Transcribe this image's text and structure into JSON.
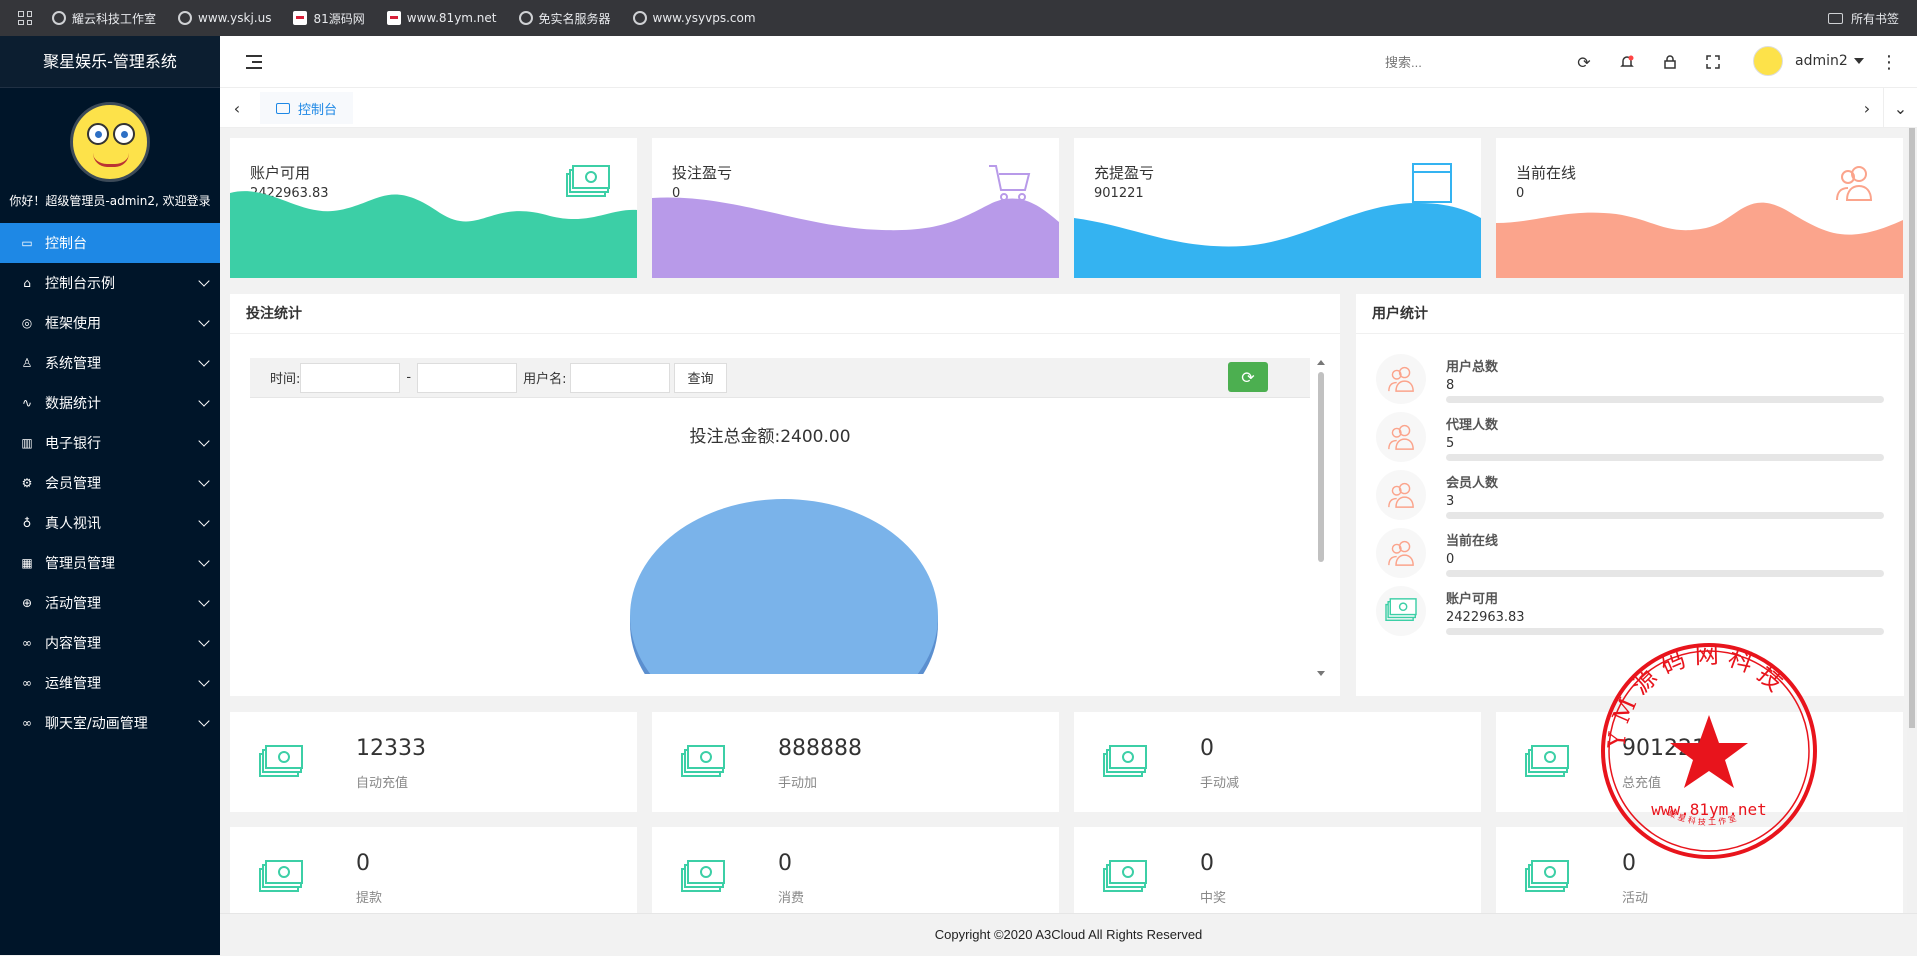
{
  "browser": {
    "bookmarks": [
      {
        "label": "耀云科技工作室",
        "icon": "globe-icon"
      },
      {
        "label": "www.yskj.us",
        "icon": "globe-icon"
      },
      {
        "label": "81源码网",
        "icon": "site-icon"
      },
      {
        "label": "www.81ym.net",
        "icon": "site-icon"
      },
      {
        "label": "免实名服务器",
        "icon": "globe-icon"
      },
      {
        "label": "www.ysyvps.com",
        "icon": "globe-icon"
      }
    ],
    "all_bookmarks": "所有书签"
  },
  "sidebar": {
    "title": "聚星娱乐-管理系统",
    "welcome": "你好！超级管理员-admin2, 欢迎登录",
    "items": [
      {
        "label": "控制台",
        "icon": "monitor-icon",
        "active": true,
        "chevron": false
      },
      {
        "label": "控制台示例",
        "icon": "home-icon",
        "chevron": true
      },
      {
        "label": "框架使用",
        "icon": "ok-icon",
        "chevron": true
      },
      {
        "label": "系统管理",
        "icon": "user-icon",
        "chevron": true
      },
      {
        "label": "数据统计",
        "icon": "pulse-icon",
        "chevron": true
      },
      {
        "label": "电子银行",
        "icon": "bank-icon",
        "chevron": true
      },
      {
        "label": "会员管理",
        "icon": "gear-icon",
        "chevron": true
      },
      {
        "label": "真人视讯",
        "icon": "flask-icon",
        "chevron": true
      },
      {
        "label": "管理员管理",
        "icon": "grid-icon",
        "chevron": true
      },
      {
        "label": "活动管理",
        "icon": "plus-circle-icon",
        "chevron": true
      },
      {
        "label": "内容管理",
        "icon": "infinity-icon",
        "chevron": true
      },
      {
        "label": "运维管理",
        "icon": "infinity-icon",
        "chevron": true
      },
      {
        "label": "聊天室/动画管理",
        "icon": "infinity-icon",
        "chevron": true
      }
    ]
  },
  "topbar": {
    "search_placeholder": "搜索...",
    "username": "admin2"
  },
  "tabs": [
    {
      "label": "控制台"
    }
  ],
  "stats": [
    {
      "title": "账户可用",
      "value": "2422963.83",
      "icon": "money-icon",
      "color": "#3ccfa6"
    },
    {
      "title": "投注盈亏",
      "value": "0",
      "icon": "cart-icon",
      "color": "#b89ae9"
    },
    {
      "title": "充提盈亏",
      "value": "901221",
      "icon": "browser-window-icon",
      "color": "#34b3f1"
    },
    {
      "title": "当前在线",
      "value": "0",
      "icon": "users-icon",
      "color": "#fba48c"
    }
  ],
  "bet_panel": {
    "title": "投注统计",
    "time_label": "时间:",
    "dash": "-",
    "username_label": "用户名:",
    "query_button": "查询",
    "chart_title": "投注总金额:2400.00"
  },
  "chart_data": {
    "type": "pie",
    "title": "投注总金额:2400.00",
    "values": [
      2400.0
    ],
    "colors": [
      "#7ab3ea"
    ]
  },
  "user_panel": {
    "title": "用户统计",
    "rows": [
      {
        "label": "用户总数",
        "value": "8",
        "icon": "users-icon"
      },
      {
        "label": "代理人数",
        "value": "5",
        "icon": "users-icon"
      },
      {
        "label": "会员人数",
        "value": "3",
        "icon": "users-icon"
      },
      {
        "label": "当前在线",
        "value": "0",
        "icon": "users-icon"
      },
      {
        "label": "账户可用",
        "value": "2422963.83",
        "icon": "money-icon"
      }
    ]
  },
  "mini_stats": [
    {
      "value": "12333",
      "label": "自动充值"
    },
    {
      "value": "888888",
      "label": "手动加"
    },
    {
      "value": "0",
      "label": "手动减"
    },
    {
      "value": "901221",
      "label": "总充值"
    },
    {
      "value": "0",
      "label": "提款"
    },
    {
      "value": "0",
      "label": "消费"
    },
    {
      "value": "0",
      "label": "中奖"
    },
    {
      "value": "0",
      "label": "活动"
    }
  ],
  "footer": {
    "copyright": "Copyright ©2020 A3Cloud All Rights Reserved"
  },
  "stamp": {
    "text": "Y M 源 码 网 科 技",
    "url": "www.81ym.net",
    "sub": "聚 星 科 技 工 作 室",
    "color": "#e8141c"
  }
}
